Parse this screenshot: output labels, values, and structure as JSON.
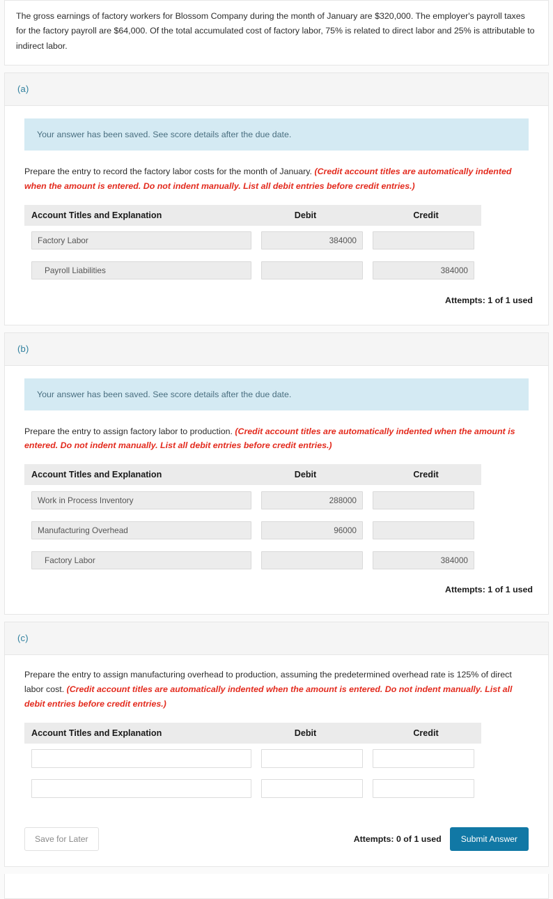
{
  "problem": {
    "text": "The gross earnings of factory workers for Blossom Company during the month of January are $320,000. The employer's payroll taxes for the factory payroll are $64,000. Of the total accumulated cost of factory labor, 75% is related to direct labor and 25% is attributable to indirect labor."
  },
  "table_headers": {
    "account": "Account Titles and Explanation",
    "debit": "Debit",
    "credit": "Credit"
  },
  "colors": {
    "part_letter": "#2d7f9d",
    "banner_bg": "#d4eaf3",
    "hint_red": "#e32b1e",
    "submit_blue": "#1178a5",
    "header_row_bg": "#ebebeb"
  },
  "parts": [
    {
      "letter": "(a)",
      "banner": "Your answer has been saved. See score details after the due date.",
      "prompt_main": "Prepare the entry to record the factory labor costs for the month of January. ",
      "prompt_hint": "(Credit account titles are automatically indented when the amount is entered. Do not indent manually. List all debit entries before credit entries.)",
      "rows": [
        {
          "account": "Factory Labor",
          "indent": false,
          "debit": "384000",
          "credit": ""
        },
        {
          "account": "Payroll Liabilities",
          "indent": true,
          "debit": "",
          "credit": "384000"
        }
      ],
      "attempts": "Attempts: 1 of 1 used"
    },
    {
      "letter": "(b)",
      "banner": "Your answer has been saved. See score details after the due date.",
      "prompt_main": "Prepare the entry to assign factory labor to production. ",
      "prompt_hint": "(Credit account titles are automatically indented when the amount is entered. Do not indent manually. List all debit entries before credit entries.)",
      "rows": [
        {
          "account": "Work in Process Inventory",
          "indent": false,
          "debit": "288000",
          "credit": ""
        },
        {
          "account": "Manufacturing Overhead",
          "indent": false,
          "debit": "96000",
          "credit": ""
        },
        {
          "account": "Factory Labor",
          "indent": true,
          "debit": "",
          "credit": "384000"
        }
      ],
      "attempts": "Attempts: 1 of 1 used"
    },
    {
      "letter": "(c)",
      "banner": null,
      "prompt_main": "Prepare the entry to assign manufacturing overhead to production, assuming the predetermined overhead rate is 125% of direct labor cost. ",
      "prompt_hint": "(Credit account titles are automatically indented when the amount is entered. Do not indent manually. List all debit entries before credit entries.)",
      "rows": [
        {
          "account": "",
          "indent": false,
          "debit": "",
          "credit": "",
          "blank": true
        },
        {
          "account": "",
          "indent": false,
          "debit": "",
          "credit": "",
          "blank": true
        }
      ],
      "attempts": "Attempts: 0 of 1 used",
      "save_label": "Save for Later",
      "submit_label": "Submit Answer"
    }
  ],
  "placeholders": {
    "account": "",
    "amount": ""
  }
}
